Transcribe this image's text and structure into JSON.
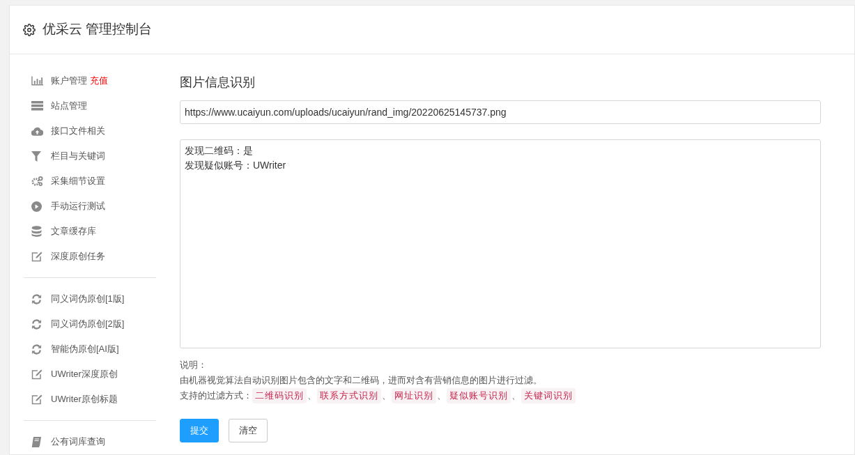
{
  "header": {
    "title": "优采云 管理控制台"
  },
  "sidebar": {
    "groups": [
      {
        "items": [
          {
            "label": "账户管理",
            "badge": "充值"
          },
          {
            "label": "站点管理"
          },
          {
            "label": "接口文件相关"
          },
          {
            "label": "栏目与关键词"
          },
          {
            "label": "采集细节设置"
          },
          {
            "label": "手动运行测试"
          },
          {
            "label": "文章缓存库"
          },
          {
            "label": "深度原创任务"
          }
        ]
      },
      {
        "items": [
          {
            "label": "同义词伪原创[1版]"
          },
          {
            "label": "同义词伪原创[2版]"
          },
          {
            "label": "智能伪原创[AI版]"
          },
          {
            "label": "UWriter深度原创"
          },
          {
            "label": "UWriter原创标题"
          }
        ]
      },
      {
        "items": [
          {
            "label": "公有词库查询"
          }
        ]
      }
    ]
  },
  "main": {
    "title": "图片信息识别",
    "url_field": {
      "value": "https://www.ucaiyun.com/uploads/ucaiyun/rand_img/20220625145737.png"
    },
    "result_area": {
      "lines": [
        "发现二维码：是",
        "发现疑似账号：UWriter"
      ]
    },
    "notes": {
      "heading": "说明：",
      "description": "由机器视觉算法自动识别图片包含的文字和二维码，进而对含有营销信息的图片进行过滤。",
      "filters_label": "支持的过滤方式：",
      "separator": "、",
      "filters": [
        "二维码识别",
        "联系方式识别",
        "网址识别",
        "疑似账号识别",
        "关键词识别"
      ]
    },
    "buttons": [
      {
        "label": "提交",
        "kind": "primary"
      },
      {
        "label": "清空",
        "kind": "default"
      }
    ]
  }
}
